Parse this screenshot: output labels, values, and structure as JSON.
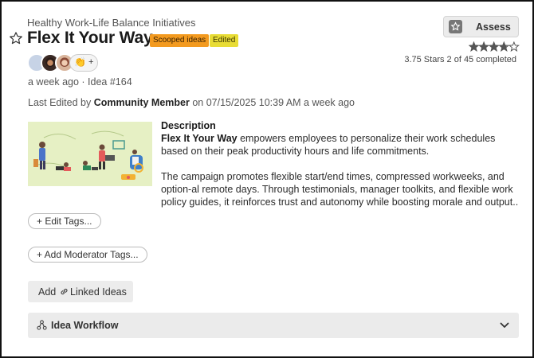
{
  "campaign": "Healthy Work-Life Balance Initiatives",
  "idea": {
    "title": "Flex It Your Way",
    "badges": [
      "Scooped ideas",
      "Edited"
    ],
    "posted": "a week ago",
    "id_label": "· Idea #164"
  },
  "last_edited": {
    "prefix": "Last Edited by",
    "user": "Community Member",
    "suffix": "on 07/15/2025 10:39 AM a week ago"
  },
  "avatars": {
    "more_icon": "clapping-hands-icon",
    "more_label": "+"
  },
  "assess": {
    "label": "Assess",
    "icon": "star-square-icon",
    "rating": 3.75,
    "rating_max": 5,
    "rating_text": "3.75 Stars 2 of 45 completed"
  },
  "description": {
    "heading": "Description",
    "lead_bold": "Flex It Your Way",
    "lead_rest": " empowers employees to personalize their work schedules based on their peak productivity hours and life commitments.",
    "para2": "The campaign promotes flexible start/end times, compressed workweeks, and option-al remote days. Through testimonials, manager toolkits, and flexible work policy guides, it reinforces trust and autonomy while boosting morale and output.."
  },
  "tags": {
    "edit_tags": "+ Edit Tags...",
    "moderator_tags": "+ Add Moderator Tags..."
  },
  "linked": {
    "label_a": "Add",
    "label_b": "Linked Ideas",
    "icon": "link-icon"
  },
  "workflow": {
    "label": "Idea Workflow",
    "icon": "workflow-icon"
  },
  "colors": {
    "badge_scooped": "#f39a1f",
    "badge_edited": "#e8dc35",
    "star": "#555555"
  }
}
